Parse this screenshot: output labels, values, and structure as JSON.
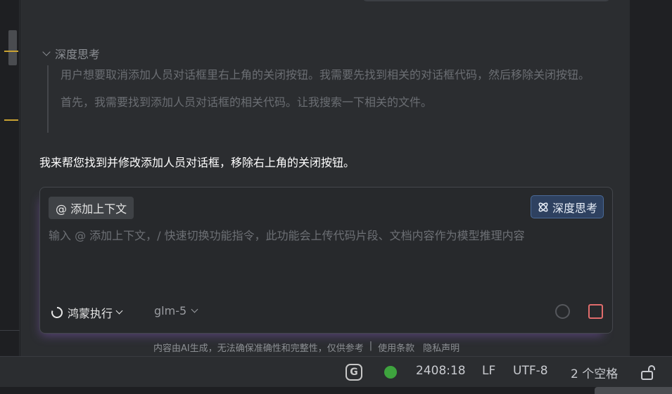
{
  "thinking": {
    "header": "深度思考",
    "paragraphs": [
      "用户想要取消添加人员对话框里右上角的关闭按钮。我需要先找到相关的对话框代码，然后移除关闭按钮。",
      "首先，我需要找到添加人员对话框的相关代码。让我搜索一下相关的文件。"
    ]
  },
  "answer": "我来帮您找到并修改添加人员对话框，移除右上角的关闭按钮。",
  "input": {
    "context_button": "@ 添加上下文",
    "deep_think_button": "深度思考",
    "placeholder": "输入 @ 添加上下文，/ 快速切换功能指令，此功能会上传代码片段、文档内容作为模型推理内容",
    "mode": "鸿蒙执行",
    "model": "glm-5"
  },
  "footer": {
    "disclaimer": "内容由AI生成，无法确保准确性和完整性，仅供参考",
    "separator": "|",
    "terms": "使用条款",
    "privacy": "隐私声明"
  },
  "status_bar": {
    "g_icon": "G",
    "status_color": "#3ea33e",
    "position": "2408:18",
    "line_ending": "LF",
    "encoding": "UTF-8",
    "indent": "2 个空格"
  }
}
